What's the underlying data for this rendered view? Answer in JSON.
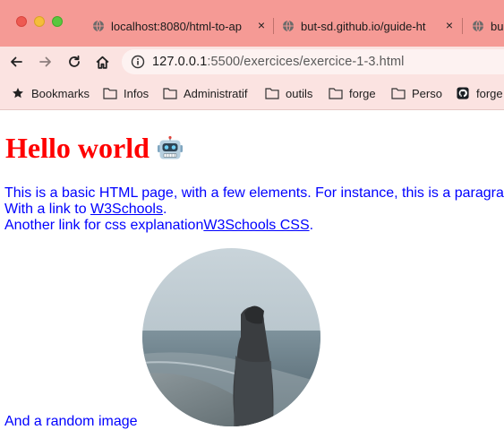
{
  "window": {
    "tabs": [
      {
        "title": "localhost:8080/html-to-ap",
        "close": "×"
      },
      {
        "title": "but-sd.github.io/guide-ht",
        "close": "×"
      },
      {
        "title": "bu",
        "close": ""
      }
    ]
  },
  "toolbar": {
    "url_host": "127.0.0.1",
    "url_rest": ":5500/exercices/exercice-1-3.html"
  },
  "bookmarks": [
    {
      "label": "Bookmarks",
      "icon": "star-icon"
    },
    {
      "label": "Infos",
      "icon": "folder-icon"
    },
    {
      "label": "Administratif",
      "icon": "folder-icon"
    },
    {
      "label": "outils",
      "icon": "folder-icon"
    },
    {
      "label": "forge",
      "icon": "folder-icon"
    },
    {
      "label": "Perso",
      "icon": "folder-icon"
    },
    {
      "label": "forge",
      "icon": "github-icon"
    }
  ],
  "page": {
    "heading": "Hello world",
    "line1": "This is a basic HTML page, with a few elements. For instance, this is a paragra",
    "line2_prefix": "With a link to ",
    "link1": "W3Schools",
    "line2_suffix": ".",
    "line3_prefix": "Another link for css explanation",
    "link2": "W3Schools CSS",
    "line3_suffix": ".",
    "caption": "And a random image"
  },
  "colors": {
    "tab_strip": "#f59a95",
    "toolbar": "#fbe3e1",
    "heading": "#ff0000",
    "text": "#0000ff"
  }
}
